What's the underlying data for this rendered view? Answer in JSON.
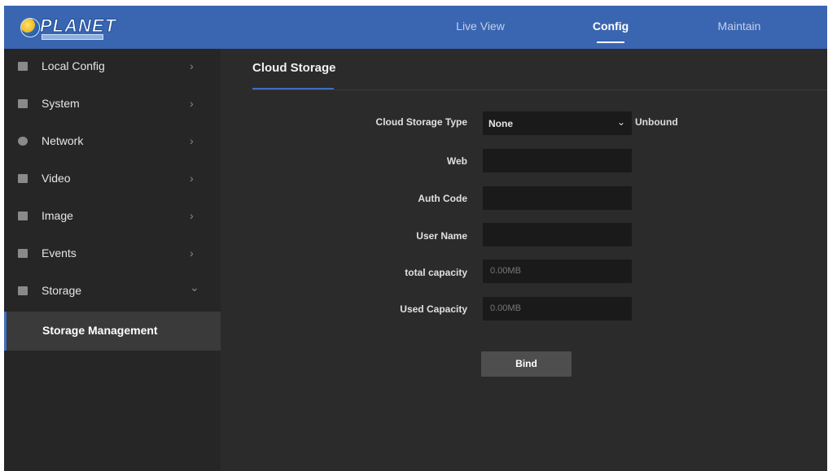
{
  "header": {
    "logo_text": "PLANET",
    "tabs": [
      {
        "label": "Live View",
        "active": false
      },
      {
        "label": "Config",
        "active": true
      },
      {
        "label": "Maintain",
        "active": false
      }
    ]
  },
  "sidebar": {
    "items": [
      {
        "label": "Local Config",
        "icon": "monitor-icon",
        "chevron": "›"
      },
      {
        "label": "System",
        "icon": "system-icon",
        "chevron": "›"
      },
      {
        "label": "Network",
        "icon": "network-icon",
        "chevron": "›"
      },
      {
        "label": "Video",
        "icon": "video-icon",
        "chevron": "›"
      },
      {
        "label": "Image",
        "icon": "image-icon",
        "chevron": "›"
      },
      {
        "label": "Events",
        "icon": "events-icon",
        "chevron": "›"
      },
      {
        "label": "Storage",
        "icon": "storage-icon",
        "chevron": "⌄"
      }
    ],
    "sub_item": {
      "label": "Storage Management"
    }
  },
  "main": {
    "tab_label": "Cloud Storage",
    "form": {
      "cloud_storage_type_label": "Cloud Storage Type",
      "cloud_storage_type_value": "None",
      "bind_status": "Unbound",
      "web_label": "Web",
      "web_value": "",
      "auth_code_label": "Auth Code",
      "auth_code_value": "",
      "user_name_label": "User Name",
      "user_name_value": "",
      "total_capacity_label": "total capacity",
      "total_capacity_value": "0.00MB",
      "used_capacity_label": "Used Capacity",
      "used_capacity_value": "0.00MB",
      "bind_button": "Bind"
    }
  },
  "colors": {
    "header_bg": "#3a65b1",
    "sidebar_bg": "#262626",
    "main_bg": "#2b2b2b",
    "input_bg": "#1a1a1a",
    "accent": "#3f6fc0"
  }
}
